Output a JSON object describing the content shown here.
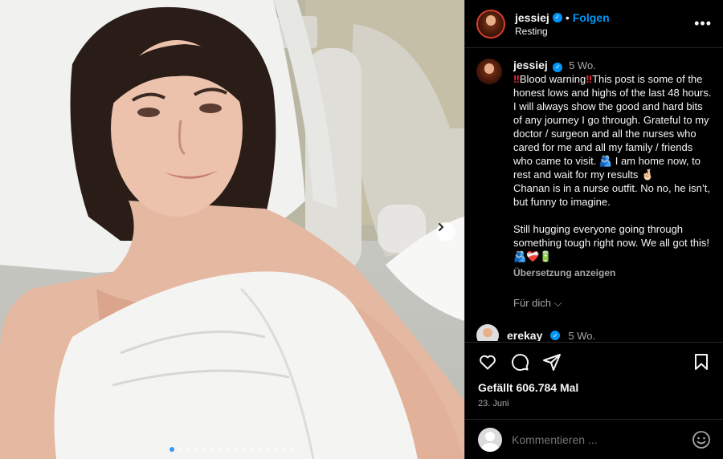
{
  "post": {
    "carousel": {
      "total": 16,
      "active_index": 0
    }
  },
  "header": {
    "username": "jessiej",
    "separator": "•",
    "follow_label": "Folgen",
    "location": "Resting",
    "more_label": "•••"
  },
  "caption": {
    "username": "jessiej",
    "time": "5 Wo.",
    "warning_icon": "‼",
    "warning_text": "Blood warning",
    "body_1": "This post is some of the honest lows and highs of the last 48 hours. I will always show the good and hard bits of any journey I go through. Grateful to my doctor / surgeon and all the nurses who cared for me and all my family / friends who came to visit. 🫂 I am home now, to rest and wait for my results 🤞🏻",
    "body_2": "Chanan is in a nurse outfit. No no, he isn’t, but funny to imagine.",
    "body_3": "Still hugging everyone going through something tough right now. We all got this! 🫂❤️‍🩹🔋",
    "translate_label": "Übersetzung anzeigen",
    "for_you_label": "Für dich ⌵"
  },
  "next_comment": {
    "username": "erekay",
    "time": "5 Wo."
  },
  "actions": {
    "likes_label": "Gefällt 606.784 Mal",
    "date_label": "23. Juni"
  },
  "composer": {
    "placeholder": "Kommentieren ..."
  },
  "colors": {
    "accent": "#0095f6",
    "warning": "#ff2a3d",
    "carousel_active": "#3897f0"
  }
}
